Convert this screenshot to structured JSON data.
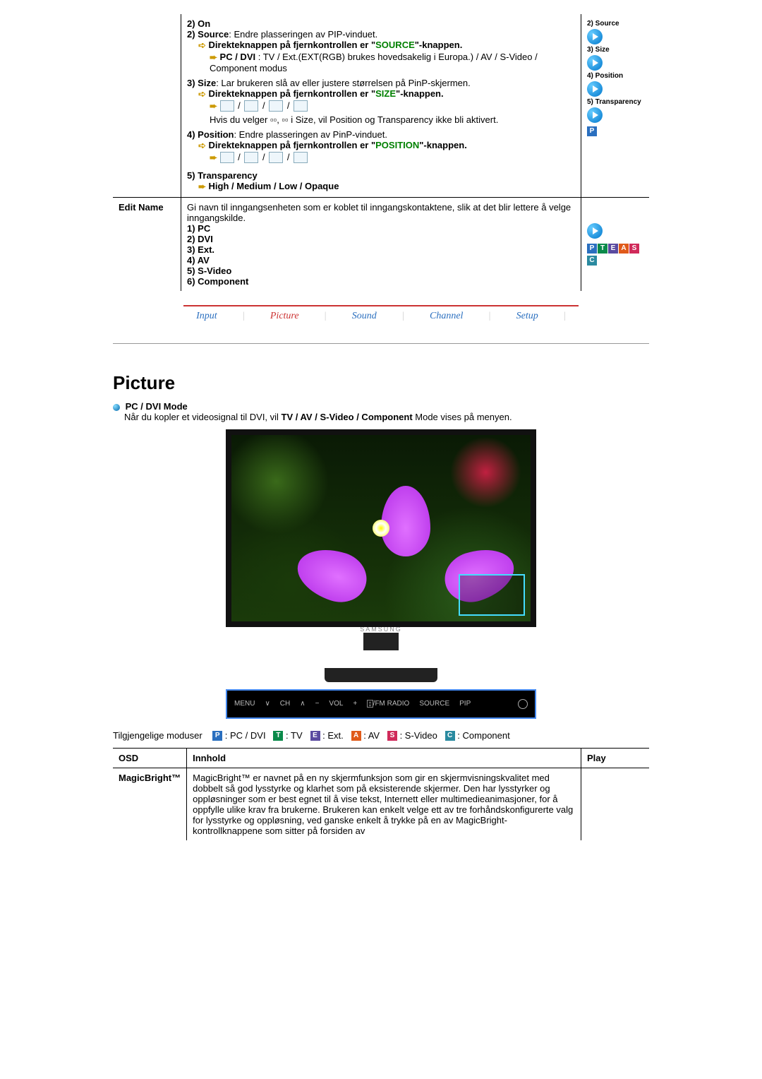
{
  "top_table": {
    "row_pip": {
      "on": "2) On",
      "source_label": "2) Source",
      "source_text": ": Endre plasseringen av PIP-vinduet.",
      "source_remote_pre": "Direkteknappen på fjernkontrollen er \"",
      "source_key": "SOURCE",
      "source_remote_post": "\"-knappen.",
      "source_modes": "PC / DVI : TV / Ext.(EXT(RGB) brukes hovedsakelig i Europa.) / AV / S-Video / Component modus",
      "size_label": "3) Size",
      "size_text": ": Lar brukeren slå av eller justere størrelsen på PinP-skjermen.",
      "size_remote_pre": "Direkteknappen på fjernkontrollen er \"",
      "size_key": "SIZE",
      "size_remote_post": "\"-knappen.",
      "size_note": "Hvis du velger ▫▫, ▫▫ i Size, vil Position og Transparency ikke bli aktivert.",
      "position_label": "4) Position",
      "position_text": ": Endre plasseringen av PinP-vinduet.",
      "position_remote_pre": "Direkteknappen på fjernkontrollen er \"",
      "position_key": "POSITION",
      "position_remote_post": "\"-knappen.",
      "transparency_label": "5) Transparency",
      "transparency_opts": "High / Medium / Low / Opaque",
      "play": {
        "l2": "2) Source",
        "l3": "3) Size",
        "l4": "4) Position",
        "l5": "5) Transparency"
      }
    },
    "row_edit": {
      "label": "Edit Name",
      "intro": "Gi navn til inngangsenheten som er koblet til inngangskontaktene, slik at det blir lettere å velge inngangskilde.",
      "opts": [
        "1) PC",
        "2) DVI",
        "3) Ext.",
        "4) AV",
        "5) S-Video",
        "6) Component"
      ]
    }
  },
  "nav": {
    "items": [
      "Input",
      "Picture",
      "Sound",
      "Channel",
      "Setup"
    ],
    "active_index": 1
  },
  "picture": {
    "heading": "Picture",
    "mode_heading": "PC / DVI Mode",
    "mode_text_1": "Når du kopler et videosignal til DVI, vil ",
    "mode_text_bold": "TV / AV / S-Video / Component",
    "mode_text_2": " Mode vises på menyen.",
    "brand": "SAMSUNG",
    "ctrl": {
      "menu": "MENU",
      "ch": "CH",
      "vol": "VOL",
      "radio": "/FM RADIO",
      "source": "SOURCE",
      "pip": "PIP"
    },
    "legend_label": "Tilgjengelige moduser",
    "legend": {
      "P": ": PC / DVI",
      "T": ": TV",
      "E": ": Ext.",
      "A": ": AV",
      "S": ": S-Video",
      "C": ": Component"
    }
  },
  "picture_table": {
    "headers": {
      "osd": "OSD",
      "innhold": "Innhold",
      "play": "Play"
    },
    "row_mb": {
      "label": "MagicBright™",
      "text": "MagicBright™ er navnet på en ny skjermfunksjon som gir en skjermvisningskvalitet med dobbelt så god lysstyrke og klarhet som på eksisterende skjermer. Den har lysstyrker og oppløsninger som er best egnet til å vise tekst, Internett eller multimedieanimasjoner, for å oppfylle ulike krav fra brukerne. Brukeren kan enkelt velge ett av tre forhåndskonfigurerte valg for lysstyrke og oppløsning, ved ganske enkelt å trykke på en av MagicBright-kontrollknappene som sitter på forsiden av"
    }
  }
}
